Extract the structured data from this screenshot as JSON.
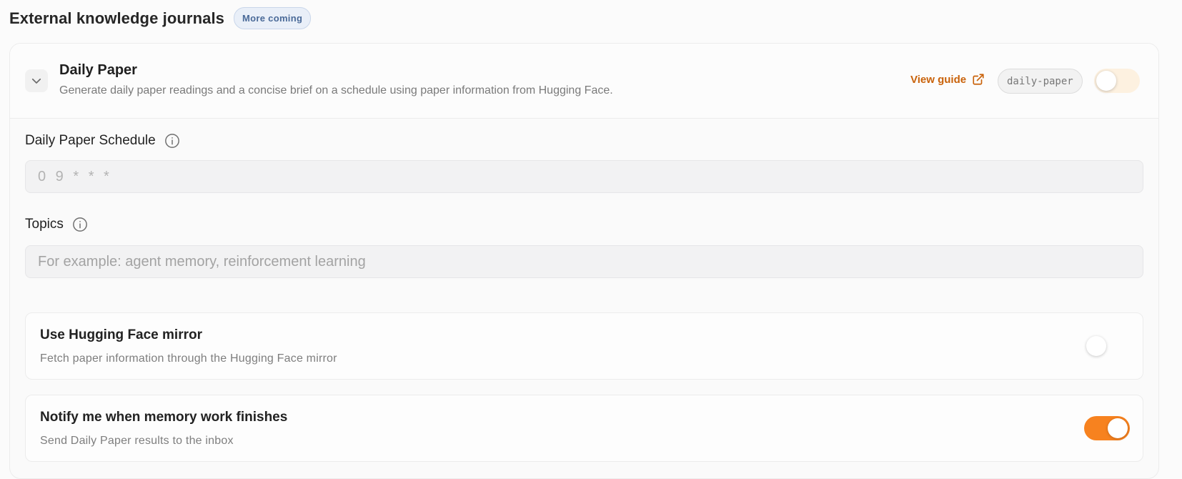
{
  "section": {
    "title": "External knowledge journals",
    "badge": "More coming"
  },
  "journal": {
    "title": "Daily Paper",
    "description": "Generate daily paper readings and a concise brief on a schedule using paper information from Hugging Face.",
    "guide_label": "View guide",
    "slug": "daily-paper",
    "enabled": false
  },
  "schedule": {
    "label": "Daily Paper Schedule",
    "placeholder": "0 9 * * *",
    "value": ""
  },
  "topics": {
    "label": "Topics",
    "placeholder": "For example: agent memory, reinforcement learning",
    "value": ""
  },
  "options": [
    {
      "title": "Use Hugging Face mirror",
      "description": "Fetch paper information through the Hugging Face mirror",
      "enabled": false
    },
    {
      "title": "Notify me when memory work finishes",
      "description": "Send Daily Paper results to the inbox",
      "enabled": true
    }
  ],
  "colors": {
    "accent": "#f7821f",
    "link": "#c9620a",
    "badge_text": "#4a6a98",
    "badge_bg": "#e9eff8"
  },
  "icons": {
    "expand": "chevron-down-icon",
    "guide": "external-link-icon",
    "info": "info-icon"
  }
}
